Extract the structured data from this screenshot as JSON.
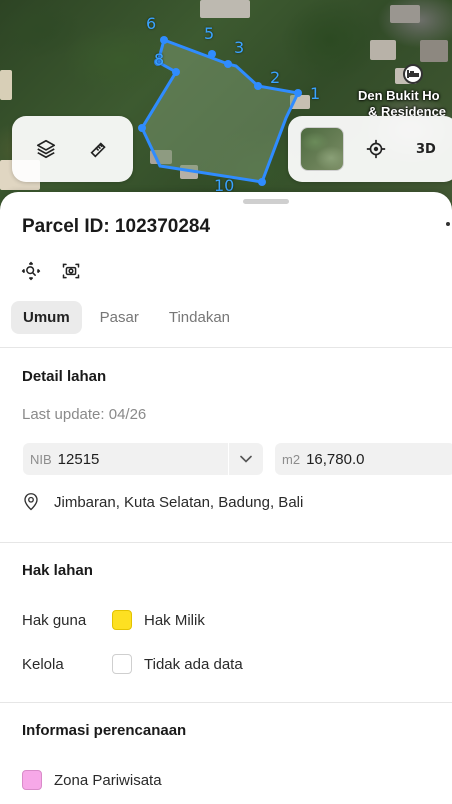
{
  "map": {
    "poi_label_line1": "Den Bukit Ho",
    "poi_label_line2": "& Residence",
    "vertex_labels": [
      "6",
      "5",
      "3",
      "2",
      "1",
      "8",
      "10"
    ],
    "parcel_stroke_color": "#2f8cff",
    "controls": {
      "layers_icon": "layers-icon",
      "measure_icon": "ruler-icon",
      "basemap_icon": "satellite-thumbnail",
      "locate_icon": "crosshair-icon",
      "label_3d": "3D"
    }
  },
  "sheet": {
    "title": "Parcel ID: 102370284",
    "tools": [
      "zoom-to-parcel-icon",
      "screenshot-icon"
    ],
    "tabs": [
      {
        "label": "Umum",
        "active": true
      },
      {
        "label": "Pasar",
        "active": false
      },
      {
        "label": "Tindakan",
        "active": false
      }
    ],
    "detail": {
      "title": "Detail lahan",
      "last_update": "Last update: 04/26",
      "nib_prefix": "NIB",
      "nib_value": "12515",
      "area_prefix": "m2",
      "area_value": "16,780.0",
      "address": "Jimbaran, Kuta Selatan, Badung, Bali"
    },
    "rights": {
      "title": "Hak lahan",
      "rows": [
        {
          "key": "Hak guna",
          "value": "Hak Milik",
          "color": "#fde022"
        },
        {
          "key": "Kelola",
          "value": "Tidak ada data",
          "color": "#ffffff"
        }
      ]
    },
    "planning": {
      "title": "Informasi perencanaan",
      "zone": "Zona Pariwisata",
      "zone_color": "#f7a8e8"
    }
  }
}
